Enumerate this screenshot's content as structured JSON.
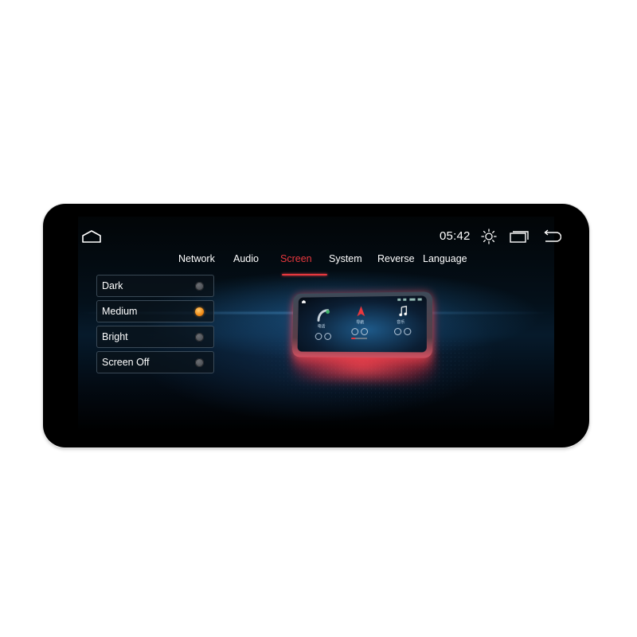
{
  "status_bar": {
    "home_icon": "home-icon",
    "time": "05:42",
    "brightness_icon": "sun-icon",
    "recents_icon": "recent-apps-icon",
    "back_icon": "back-arrow-icon"
  },
  "tabs": [
    {
      "label": "Network",
      "active": false
    },
    {
      "label": "Audio",
      "active": false
    },
    {
      "label": "Screen",
      "active": true
    },
    {
      "label": "System",
      "active": false
    },
    {
      "label": "Reverse",
      "active": false
    },
    {
      "label": "Language",
      "active": false
    }
  ],
  "brightness_options": [
    {
      "label": "Dark",
      "selected": false
    },
    {
      "label": "Medium",
      "selected": true
    },
    {
      "label": "Bright",
      "selected": false
    },
    {
      "label": "Screen Off",
      "selected": false
    }
  ],
  "preview": {
    "phone_label": "电话",
    "nav_label": "导航",
    "music_label": "音乐"
  },
  "colors": {
    "accent_active_tab": "#e8383e",
    "radio_selected": "#f08a16",
    "radio_unselected": "#55585d",
    "background": "#000000"
  }
}
